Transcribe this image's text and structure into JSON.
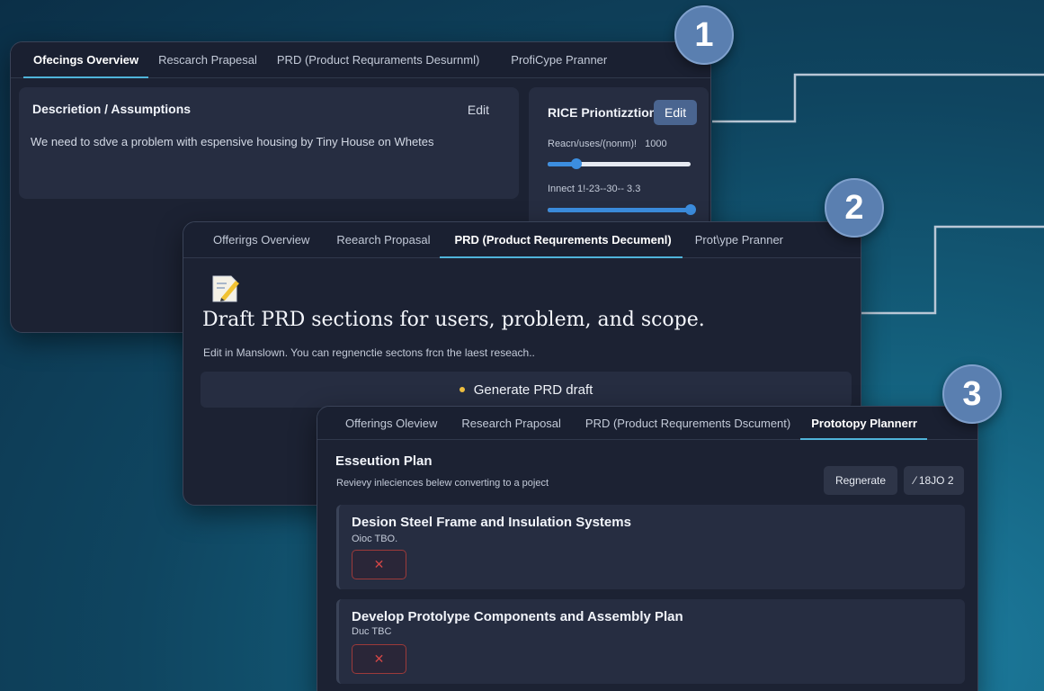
{
  "badges": [
    "1",
    "2",
    "3"
  ],
  "panel1": {
    "tabs": [
      {
        "label": "Ofecings Overview",
        "active": true
      },
      {
        "label": "Rescarch Prapesal",
        "active": false
      },
      {
        "label": "PRD (Product Requraments Desurnml)",
        "active": false
      },
      {
        "label": "ProfiCype Pranner",
        "active": false
      }
    ],
    "description": {
      "title": "Descrietion / Assumptions",
      "edit_label": "Edit",
      "text": "We need to sdve a problem with espensive housing by Tiny House on Whetes"
    },
    "rice": {
      "title": "RICE Priontizztion",
      "edit_label": "Edit",
      "reach_label": "Reacn/uses/(nonm)!",
      "reach_value": "1000",
      "reach_fraction": 0.2,
      "impact_label": "Innect 1!-23--30-- 3.3",
      "impact_fraction": 1.0
    }
  },
  "panel2": {
    "tabs": [
      {
        "label": "Offerirgs Overview",
        "active": false
      },
      {
        "label": "Reearch Propasal",
        "active": false
      },
      {
        "label": "PRD (Product Requrements Decumenl)",
        "active": true
      },
      {
        "label": "Prot\\ype Pranner",
        "active": false
      }
    ],
    "icon": "memo-pencil-icon",
    "heading": "Draft PRD sections for users, problem, and scope.",
    "subtext": "Edit in Manslown. You can regnenctie sectons frcn the laest reseach..",
    "generate_label": "Generate PRD draft"
  },
  "panel3": {
    "tabs": [
      {
        "label": "Offerings Oleview",
        "active": false
      },
      {
        "label": "Research Praposal",
        "active": false
      },
      {
        "label": "PRD (Product Requrements Dscument)",
        "active": false
      },
      {
        "label": "Prototopy Plannerr",
        "active": true
      }
    ],
    "plan_title": "Esseution Plan",
    "plan_subtitle": "Revievy inleciences belew converting to a poject",
    "regenerate_label": "Regnerate",
    "extra_label": "⁄ 18JO 2",
    "items": [
      {
        "title": "Desion Steel Frame and Insulation Systems",
        "due": "Oioc TBO."
      },
      {
        "title": "Develop Protolype Components and Assembly Plan",
        "due": "Duc TBC"
      }
    ]
  },
  "colors": {
    "accent": "#4fb3d9",
    "badge": "#5a7fb0",
    "delete": "#d24646",
    "slider": "#3c8ee0"
  }
}
